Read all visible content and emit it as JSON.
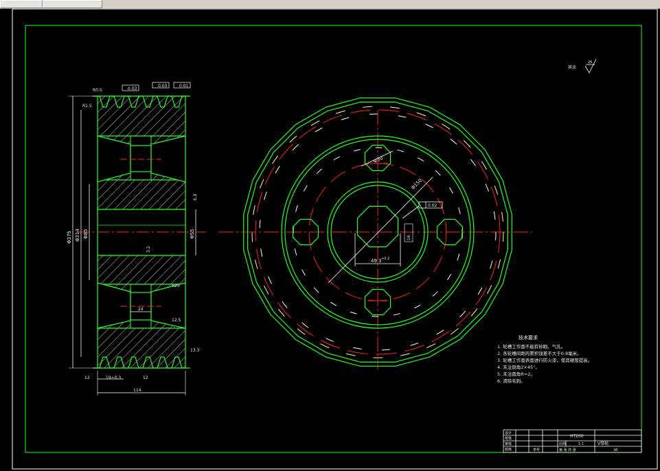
{
  "surface_roughness": {
    "label": "其余",
    "value": "25"
  },
  "tech_requirements": {
    "title": "技术要求",
    "items": [
      "1. 轮槽工作面不能有砂眼、气孔。",
      "2. 各轮槽间距的累积误差不大于0.8毫米。",
      "3. 轮槽工作面表面进行防火漆，使其硬度提高。",
      "4. 未注倒角2×45°。",
      "5. 未注圆角R=2。",
      "6. 清除毛刺。"
    ]
  },
  "title_block": {
    "material": "HT200",
    "scale_label": "比例",
    "scale": "1:1",
    "part_name": "V带轮",
    "sheet_label": "第 张 共 张",
    "number": "38",
    "rows": [
      "设计",
      "校核",
      "审核",
      "班级"
    ],
    "student_no": "学号"
  },
  "section_view": {
    "dims": {
      "d_outer": "Φ375",
      "d_inner": "Φ314",
      "d_hub": "Φ85",
      "bore": "Φ55",
      "groove_pitch": "19±0.3",
      "groove_edge": "12",
      "groove_edge2": "12",
      "width": "114",
      "web": "24",
      "r1": "R0.5",
      "r2": "R0.5",
      "r3": "R1.5",
      "r4": "R25",
      "key": "13.3",
      "tol1": "+0.5",
      "tol2": "0",
      "gdt1": "0.03",
      "gdt2": "0.03",
      "gdt3": "0.01",
      "rough1": "6.3",
      "rough2": "3.2",
      "rough3": "12.5",
      "rough4": "12.5",
      "angle": "38°"
    }
  },
  "front_view": {
    "dims": {
      "hole_pcd": "Φ150",
      "hole_d": "Φ30",
      "keyway": "49.3",
      "keyway_tol": "+0.2",
      "gdt": "0.02",
      "key_w": "16"
    }
  }
}
